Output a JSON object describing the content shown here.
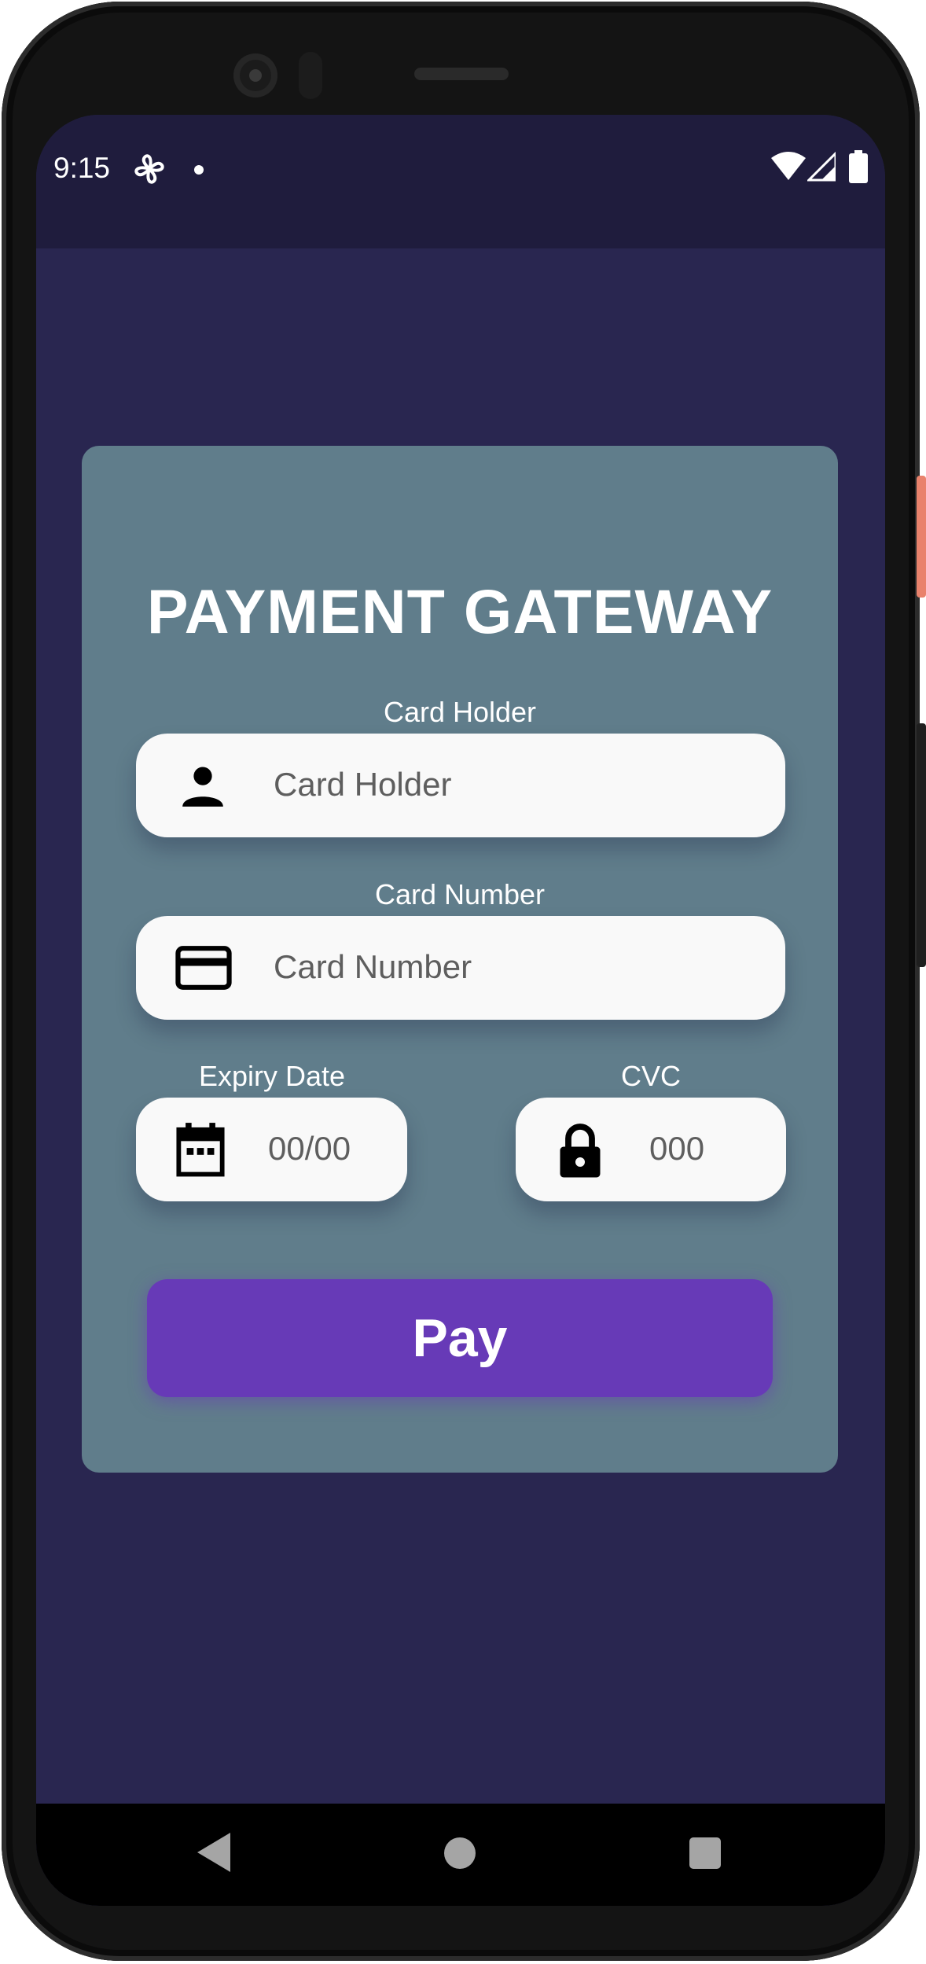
{
  "status_bar": {
    "time": "9:15",
    "icons": [
      "fan-icon",
      "notification-dot-icon",
      "wifi-icon",
      "cell-signal-icon",
      "battery-icon"
    ]
  },
  "form": {
    "title": "PAYMENT GATEWAY",
    "card_holder": {
      "label": "Card Holder",
      "placeholder": "Card Holder",
      "icon": "person-icon"
    },
    "card_number": {
      "label": "Card Number",
      "placeholder": "Card Number",
      "icon": "credit-card-icon"
    },
    "expiry": {
      "label": "Expiry Date",
      "placeholder": "00/00",
      "icon": "calendar-icon"
    },
    "cvc": {
      "label": "CVC",
      "placeholder": "000",
      "icon": "lock-icon"
    },
    "pay_label": "Pay"
  },
  "navigation": {
    "buttons": [
      "back-icon",
      "home-icon",
      "recents-icon"
    ]
  },
  "colors": {
    "screen_background": "#292650",
    "status_bar": "#1f1c3d",
    "card_background": "#607d8b",
    "field_background": "#f9f9f9",
    "pay_button": "#673ab7",
    "nav_bar": "#000000"
  }
}
